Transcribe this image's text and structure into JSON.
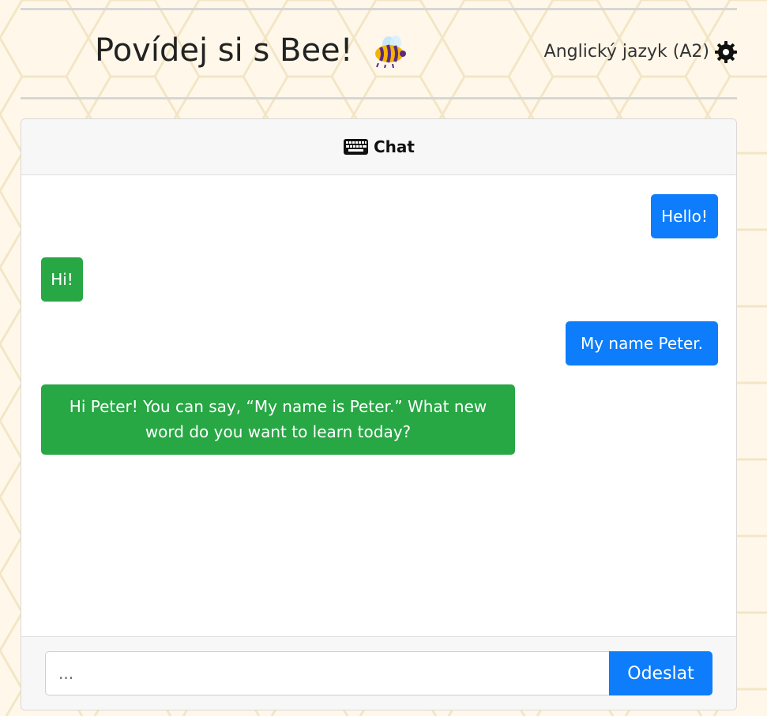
{
  "header": {
    "title": "Povídej si s Bee!",
    "language_label": "Anglický jazyk (A2)"
  },
  "chat": {
    "title": "Chat",
    "messages": [
      {
        "role": "user",
        "text": "Hello!"
      },
      {
        "role": "bot",
        "text": "Hi!"
      },
      {
        "role": "user",
        "text": "My name Peter."
      },
      {
        "role": "bot",
        "text": "Hi Peter! You can say, “My name is Peter.” What new word do you want to learn today?"
      }
    ]
  },
  "composer": {
    "placeholder": "...",
    "send_label": "Odeslat"
  },
  "colors": {
    "user_bubble": "#0d7dfb",
    "bot_bubble": "#28a745",
    "send_button": "#0d7dfb",
    "background": "#fff8ea"
  },
  "icons": [
    "bee-icon",
    "gear-icon",
    "keyboard-icon"
  ]
}
